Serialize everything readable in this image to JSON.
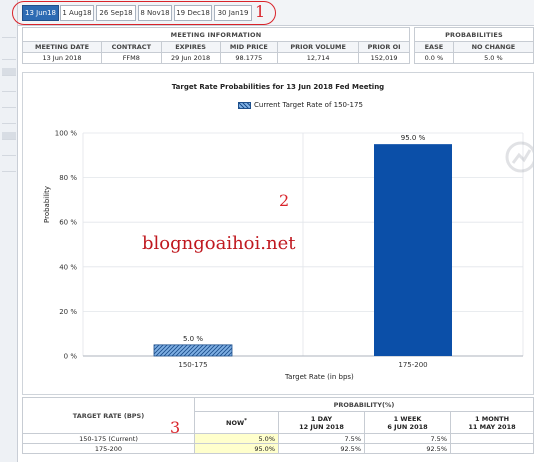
{
  "tabs": [
    {
      "label": "13 Jun18",
      "active": true
    },
    {
      "label": "1 Aug18",
      "active": false
    },
    {
      "label": "26 Sep18",
      "active": false
    },
    {
      "label": "8 Nov18",
      "active": false
    },
    {
      "label": "19 Dec18",
      "active": false
    },
    {
      "label": "30 Jan19",
      "active": false
    }
  ],
  "annotations": {
    "one": "1",
    "two": "2",
    "three": "3"
  },
  "meeting_info": {
    "section_title": "MEETING INFORMATION",
    "headers": [
      "MEETING DATE",
      "CONTRACT",
      "EXPIRES",
      "MID PRICE",
      "PRIOR VOLUME",
      "PRIOR OI"
    ],
    "values": [
      "13 Jun 2018",
      "FFM8",
      "29 Jun 2018",
      "98.1775",
      "12,714",
      "152,019"
    ]
  },
  "probabilities_info": {
    "section_title": "PROBABILITIES",
    "headers": [
      "EASE",
      "NO CHANGE"
    ],
    "values": [
      "0.0 %",
      "5.0 %"
    ]
  },
  "chart_data": {
    "type": "bar",
    "title": "Target Rate Probabilities for 13 Jun 2018 Fed Meeting",
    "legend": "Current Target Rate of 150-175",
    "categories": [
      "150-175",
      "175-200"
    ],
    "values": [
      5.0,
      95.0
    ],
    "value_labels": [
      "5.0 %",
      "95.0 %"
    ],
    "xlabel": "Target Rate (in bps)",
    "ylabel": "Probability",
    "ylim": [
      0,
      100
    ],
    "yticks": [
      0,
      20,
      40,
      60,
      80,
      100
    ],
    "ytick_labels": [
      "0 %",
      "20 %",
      "40 %",
      "60 %",
      "80 %",
      "100 %"
    ],
    "grid": true,
    "colors": {
      "hatched": "#1d4f8c",
      "solid": "#0b4fa8"
    }
  },
  "watermark": "blogngoaihoi.net",
  "probability_table": {
    "target_header": "TARGET RATE (BPS)",
    "prob_header": "PROBABILITY(%)",
    "columns": [
      {
        "label": "NOW",
        "marker": "*",
        "sub": ""
      },
      {
        "label": "1 DAY",
        "sub": "12 JUN 2018"
      },
      {
        "label": "1 WEEK",
        "sub": "6 JUN 2018"
      },
      {
        "label": "1 MONTH",
        "sub": "11 MAY 2018"
      }
    ],
    "rows": [
      {
        "rate": "150-175 (Current)",
        "now": "5.0%",
        "day": "7.5%",
        "week": "7.5%",
        "month": ""
      },
      {
        "rate": "175-200",
        "now": "95.0%",
        "day": "92.5%",
        "week": "92.5%",
        "month": ""
      }
    ]
  }
}
